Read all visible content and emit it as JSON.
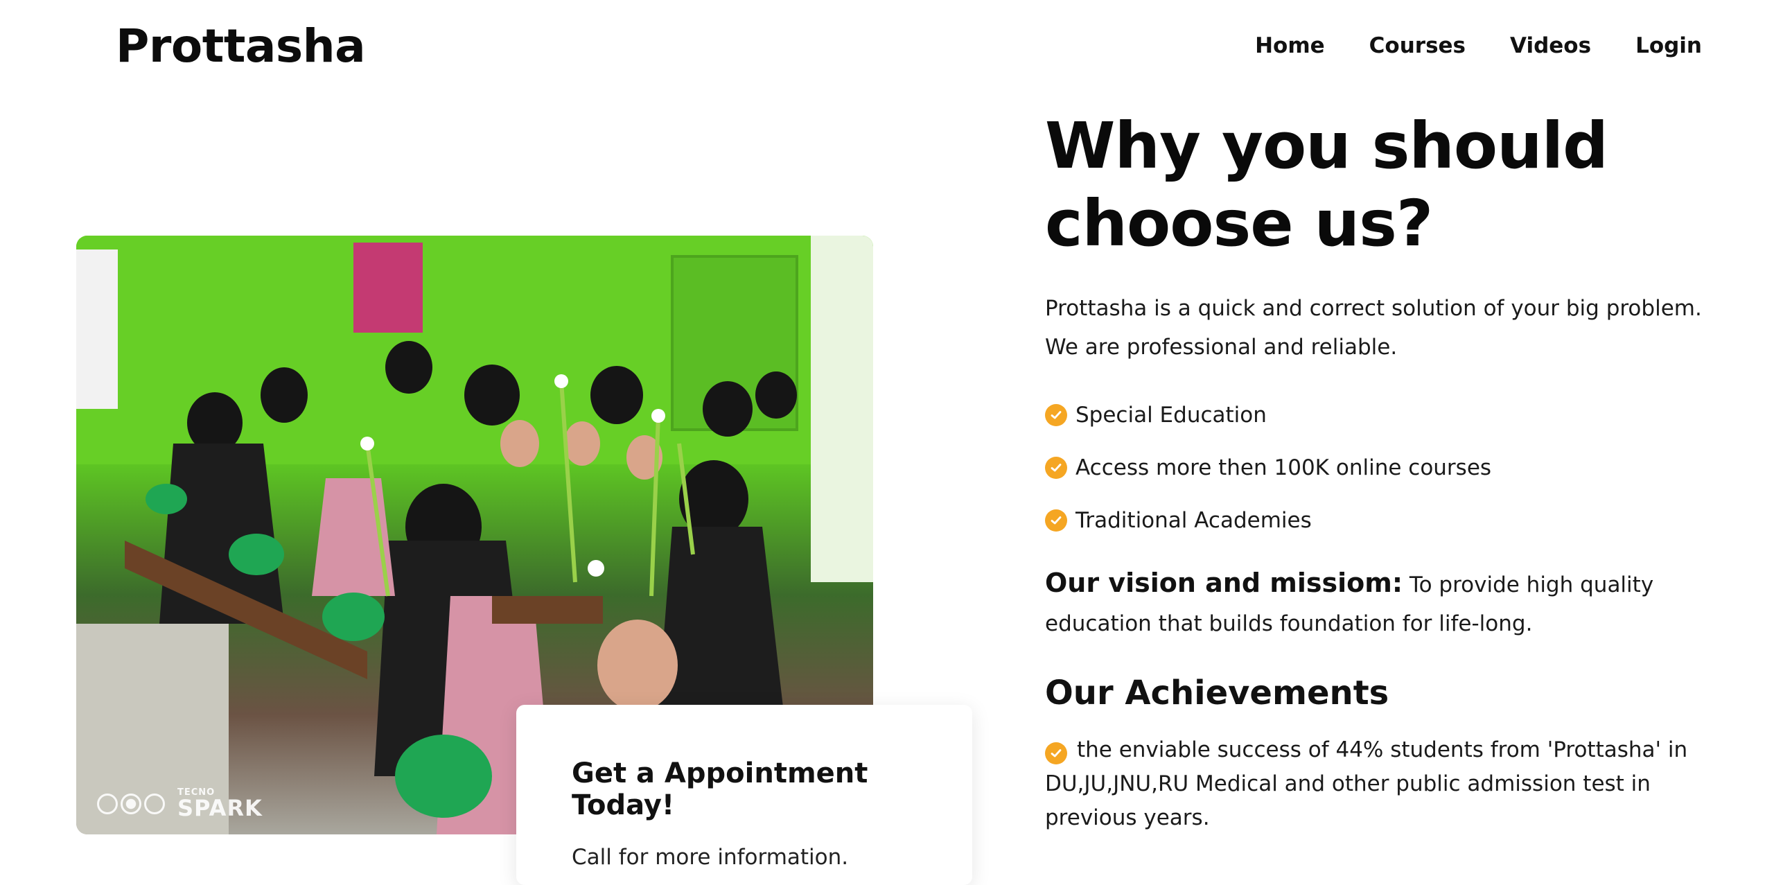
{
  "header": {
    "logo": "Prottasha",
    "nav": [
      "Home",
      "Courses",
      "Videos",
      "Login"
    ]
  },
  "photo": {
    "watermark_small": "TECNO",
    "watermark_big": "SPARK"
  },
  "appointment": {
    "title": "Get a Appointment Today!",
    "subtitle": "Call for more information."
  },
  "why": {
    "heading_line1": "Why you should",
    "heading_line2": "choose us?",
    "intro": "Prottasha is a quick and correct solution of your big problem. We are professional and reliable.",
    "features": [
      "Special Education",
      "Access more then 100K online courses",
      "Traditional Academies"
    ],
    "vision_label": "Our vision and missiom:",
    "vision_text": " To provide high quality education that builds foundation for life-long.",
    "achievements_title": "Our Achievements",
    "achievements": [
      "the enviable success of 44% students from 'Prottasha' in DU,JU,JNU,RU Medical and other public admission test in previous years."
    ]
  },
  "colors": {
    "accent": "#f5a623",
    "text": "#111111",
    "background": "#ffffff"
  }
}
